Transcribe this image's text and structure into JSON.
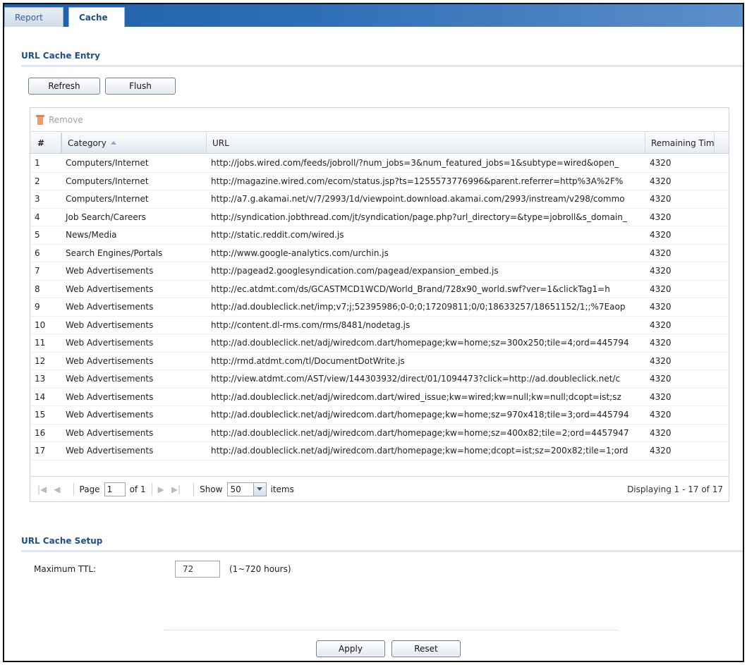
{
  "tabs": [
    {
      "label": "Report",
      "active": false
    },
    {
      "label": "Cache",
      "active": true
    }
  ],
  "cache_entry": {
    "title": "URL Cache Entry",
    "refresh_label": "Refresh",
    "flush_label": "Flush",
    "remove_label": "Remove",
    "columns": [
      "#",
      "Category",
      "URL",
      "Remaining Time"
    ],
    "rows": [
      [
        "1",
        "Computers/Internet",
        "http://jobs.wired.com/feeds/jobroll/?num_jobs=3&num_featured_jobs=1&subtype=wired&open_",
        "4320"
      ],
      [
        "2",
        "Computers/Internet",
        "http://magazine.wired.com/ecom/status.jsp?ts=1255573776996&parent.referrer=http%3A%2F%",
        "4320"
      ],
      [
        "3",
        "Computers/Internet",
        "http://a7.g.akamai.net/v/7/2993/1d/viewpoint.download.akamai.com/2993/instream/v298/commo",
        "4320"
      ],
      [
        "4",
        "Job Search/Careers",
        "http://syndication.jobthread.com/jt/syndication/page.php?url_directory=&type=jobroll&s_domain_",
        "4320"
      ],
      [
        "5",
        "News/Media",
        "http://static.reddit.com/wired.js",
        "4320"
      ],
      [
        "6",
        "Search Engines/Portals",
        "http://www.google-analytics.com/urchin.js",
        "4320"
      ],
      [
        "7",
        "Web Advertisements",
        "http://pagead2.googlesyndication.com/pagead/expansion_embed.js",
        "4320"
      ],
      [
        "8",
        "Web Advertisements",
        "http://ec.atdmt.com/ds/GCASTMCD1WCD/World_Brand/728x90_world.swf?ver=1&clickTag1=h",
        "4320"
      ],
      [
        "9",
        "Web Advertisements",
        "http://ad.doubleclick.net/imp;v7;j;52395986;0-0;0;17209811;0/0;18633257/18651152/1;;%7Eaop",
        "4320"
      ],
      [
        "10",
        "Web Advertisements",
        "http://content.dl-rms.com/rms/8481/nodetag.js",
        "4320"
      ],
      [
        "11",
        "Web Advertisements",
        "http://ad.doubleclick.net/adj/wiredcom.dart/homepage;kw=home;sz=300x250;tile=4;ord=445794",
        "4320"
      ],
      [
        "12",
        "Web Advertisements",
        "http://rmd.atdmt.com/tl/DocumentDotWrite.js",
        "4320"
      ],
      [
        "13",
        "Web Advertisements",
        "http://view.atdmt.com/AST/view/144303932/direct/01/1094473?click=http://ad.doubleclick.net/c",
        "4320"
      ],
      [
        "14",
        "Web Advertisements",
        "http://ad.doubleclick.net/adj/wiredcom.dart/wired_issue;kw=wired;kw=null;kw=null;dcopt=ist;sz",
        "4320"
      ],
      [
        "15",
        "Web Advertisements",
        "http://ad.doubleclick.net/adj/wiredcom.dart/homepage;kw=home;sz=970x418;tile=3;ord=445794",
        "4320"
      ],
      [
        "16",
        "Web Advertisements",
        "http://ad.doubleclick.net/adj/wiredcom.dart/homepage;kw=home;sz=400x82;tile=2;ord=4457947",
        "4320"
      ],
      [
        "17",
        "Web Advertisements",
        "http://ad.doubleclick.net/adj/wiredcom.dart/homepage;kw=home;dcopt=ist;sz=200x82;tile=1;ord",
        "4320"
      ]
    ],
    "pager": {
      "page_label": "Page",
      "page_value": "1",
      "of_label": "of 1",
      "show_label": "Show",
      "show_value": "50",
      "items_label": "items",
      "displaying": "Displaying 1 - 17 of 17"
    }
  },
  "cache_setup": {
    "title": "URL Cache Setup",
    "max_ttl_label": "Maximum TTL:",
    "max_ttl_value": "72",
    "max_ttl_hint": "(1~720 hours)"
  },
  "footer": {
    "apply_label": "Apply",
    "reset_label": "Reset"
  }
}
